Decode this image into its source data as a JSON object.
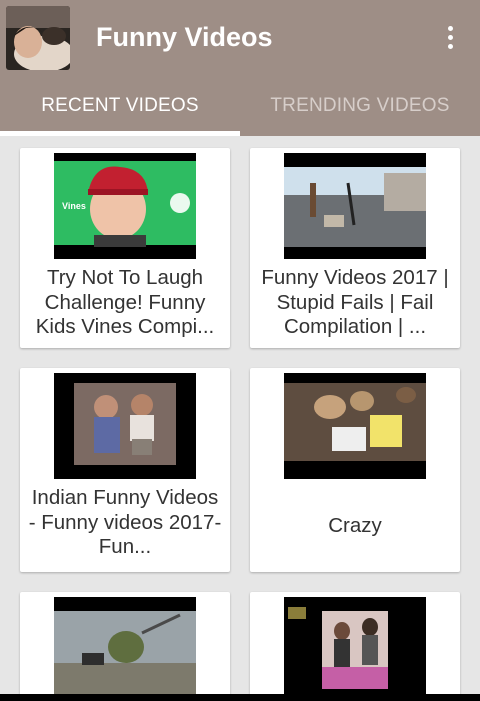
{
  "app": {
    "title": "Funny Videos"
  },
  "tabs": [
    {
      "label": "RECENT VIDEOS"
    },
    {
      "label": "TRENDING VIDEOS"
    }
  ],
  "videos": [
    {
      "title": "Try Not To Laugh Challenge! Funny Kids Vines Compi...",
      "thumb_watermark": "Vines"
    },
    {
      "title": "Funny Videos 2017 | Stupid Fails | Fail Compilation | ..."
    },
    {
      "title": "Indian Funny Videos - Funny videos 2017- Fun..."
    },
    {
      "title": "Crazy"
    },
    {
      "title": ""
    },
    {
      "title": ""
    }
  ],
  "colors": {
    "appbar": "#9e8e86",
    "background": "#e6e6e6",
    "tab_active": "#ffffff",
    "tab_inactive": "#d7ceca"
  }
}
